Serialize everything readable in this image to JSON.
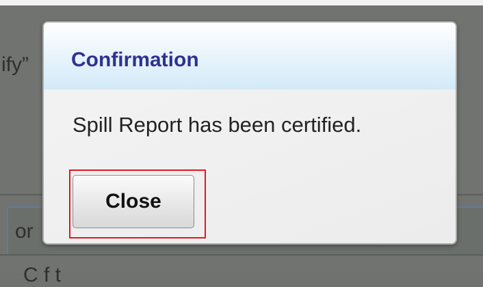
{
  "background": {
    "text_fragment_1": "ify”",
    "text_fragment_2": "or",
    "text_fragment_3": "C            f    t"
  },
  "dialog": {
    "title": "Confirmation",
    "message": "Spill Report has been certified.",
    "close_label": "Close"
  },
  "colors": {
    "title": "#2f3191",
    "highlight": "#e2161c",
    "overlay": "#70736f"
  }
}
